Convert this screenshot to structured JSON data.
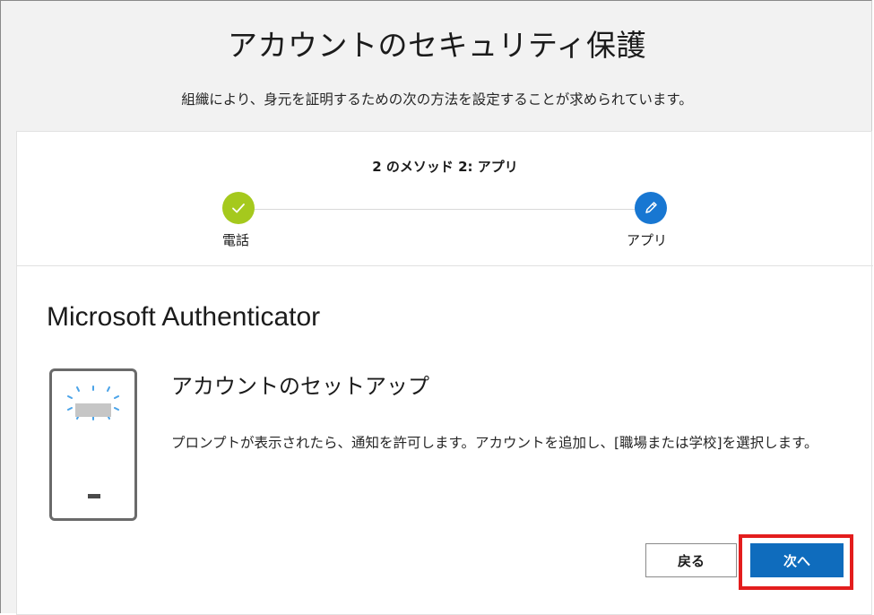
{
  "page": {
    "title": "アカウントのセキュリティ保護",
    "subtitle": "組織により、身元を証明するための次の方法を設定することが求められています。"
  },
  "wizard": {
    "step_label": "2 のメソッド 2: アプリ",
    "steps": [
      {
        "name": "電話",
        "status": "completed",
        "icon": "checkmark-icon",
        "color": "#a5c91d"
      },
      {
        "name": "アプリ",
        "status": "current",
        "icon": "pencil-icon",
        "color": "#1877d2"
      }
    ]
  },
  "content": {
    "app_title": "Microsoft Authenticator",
    "setup_title": "アカウントのセットアップ",
    "description": "プロンプトが表示されたら、通知を許可します。アカウントを追加し、[職場または学校]を選択します。",
    "phone_icon": "phone-icon"
  },
  "buttons": {
    "back_label": "戻る",
    "next_label": "次へ",
    "next_color": "#0f6cbd",
    "highlight_color": "#e31d1d"
  }
}
